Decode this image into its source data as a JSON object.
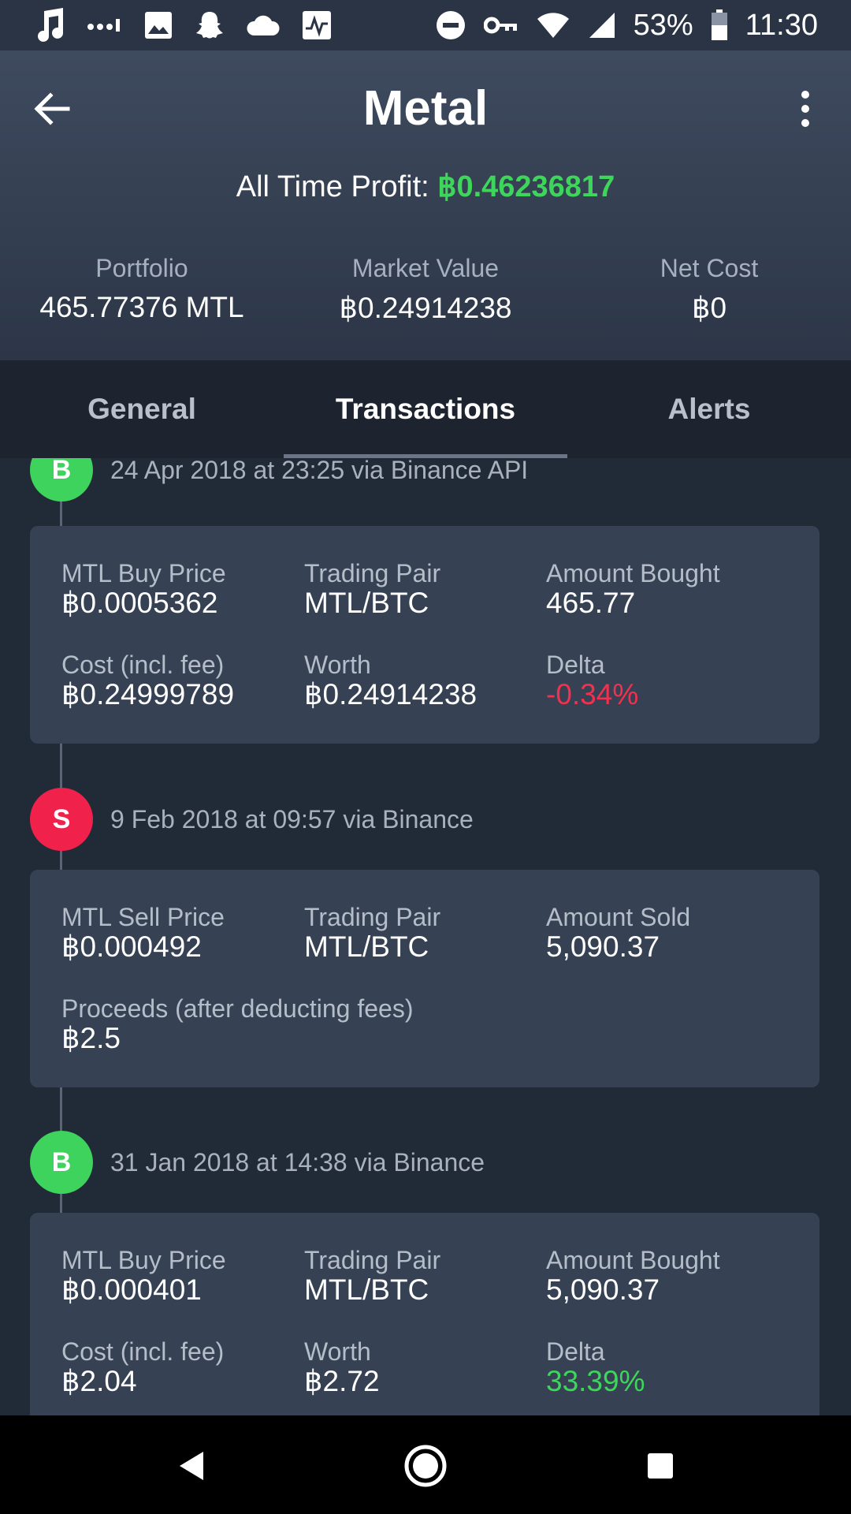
{
  "status_bar": {
    "left_icons": [
      "music-icon",
      "dots-icon",
      "image-icon",
      "snapchat-icon",
      "cloud-icon",
      "pulse-icon"
    ],
    "battery_percent": "53%",
    "time": "11:30"
  },
  "header": {
    "title": "Metal",
    "profit_label": "All Time Profit: ",
    "profit_value": "฿0.46236817",
    "profit_color": "#3dd65a",
    "stats": [
      {
        "label": "Portfolio",
        "value": "465.77376 MTL"
      },
      {
        "label": "Market Value",
        "value": "฿0.24914238"
      },
      {
        "label": "Net Cost",
        "value": "฿0"
      }
    ]
  },
  "tabs": [
    {
      "label": "General",
      "active": false
    },
    {
      "label": "Transactions",
      "active": true
    },
    {
      "label": "Alerts",
      "active": false
    }
  ],
  "transactions": [
    {
      "type": "B",
      "date": "24 Apr 2018 at 23:25 via Binance API",
      "fields": [
        {
          "label": "MTL Buy Price",
          "value": "฿0.0005362"
        },
        {
          "label": "Trading Pair",
          "value": "MTL/BTC"
        },
        {
          "label": "Amount Bought",
          "value": "465.77"
        },
        {
          "label": "Cost (incl. fee)",
          "value": "฿0.24999789"
        },
        {
          "label": "Worth",
          "value": "฿0.24914238"
        },
        {
          "label": "Delta",
          "value": "-0.34%"
        }
      ]
    },
    {
      "type": "S",
      "date": "9 Feb 2018 at 09:57 via Binance",
      "fields": [
        {
          "label": "MTL Sell Price",
          "value": "฿0.000492"
        },
        {
          "label": "Trading Pair",
          "value": "MTL/BTC"
        },
        {
          "label": "Amount Sold",
          "value": "5,090.37"
        },
        {
          "label": "Proceeds (after deducting fees)",
          "value": "฿2.5"
        }
      ]
    },
    {
      "type": "B",
      "date": "31 Jan 2018 at 14:38 via Binance",
      "fields": [
        {
          "label": "MTL Buy Price",
          "value": "฿0.000401"
        },
        {
          "label": "Trading Pair",
          "value": "MTL/BTC"
        },
        {
          "label": "Amount Bought",
          "value": "5,090.37"
        },
        {
          "label": "Cost (incl. fee)",
          "value": "฿2.04"
        },
        {
          "label": "Worth",
          "value": "฿2.72"
        },
        {
          "label": "Delta",
          "value": "33.39%"
        }
      ]
    }
  ],
  "colors": {
    "buy": "#3ed35c",
    "sell": "#f0224c",
    "negative": "#f2304f",
    "positive": "#3dd65a"
  }
}
